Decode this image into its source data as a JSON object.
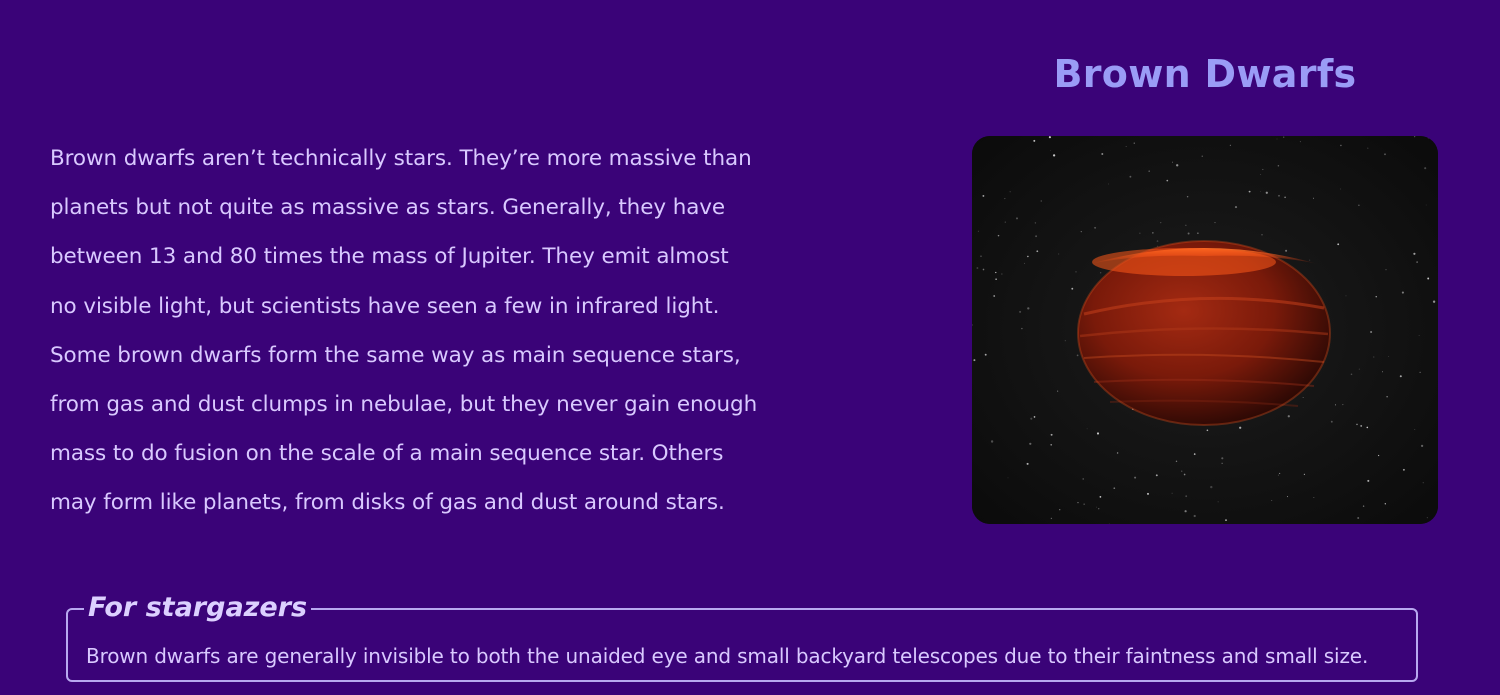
{
  "header": {
    "title": "Brown Dwarfs"
  },
  "main": {
    "paragraph": "Brown dwarfs aren’t technically stars. They’re more massive than\nplanets but not quite as massive as stars. Generally, they have\nbetween 13 and 80 times the mass of Jupiter. They emit almost\nno visible light, but scientists have seen a few in infrared light.\nSome brown dwarfs form the same way as main sequence stars,\nfrom gas and dust clumps in nebulae, but they never gain enough\nmass to do fusion on the scale of a main sequence star. Others\nmay form like planets, from disks of gas and dust around stars."
  },
  "stargazers": {
    "heading": "For stargazers",
    "text": "Brown dwarfs are generally invisible to both the unaided eye and small backyard telescopes due to their faintness and small size."
  },
  "colors": {
    "background": "#3a0378",
    "title": "#9a9cf6",
    "text": "#d9c9ff",
    "border": "#b8a9f0"
  }
}
